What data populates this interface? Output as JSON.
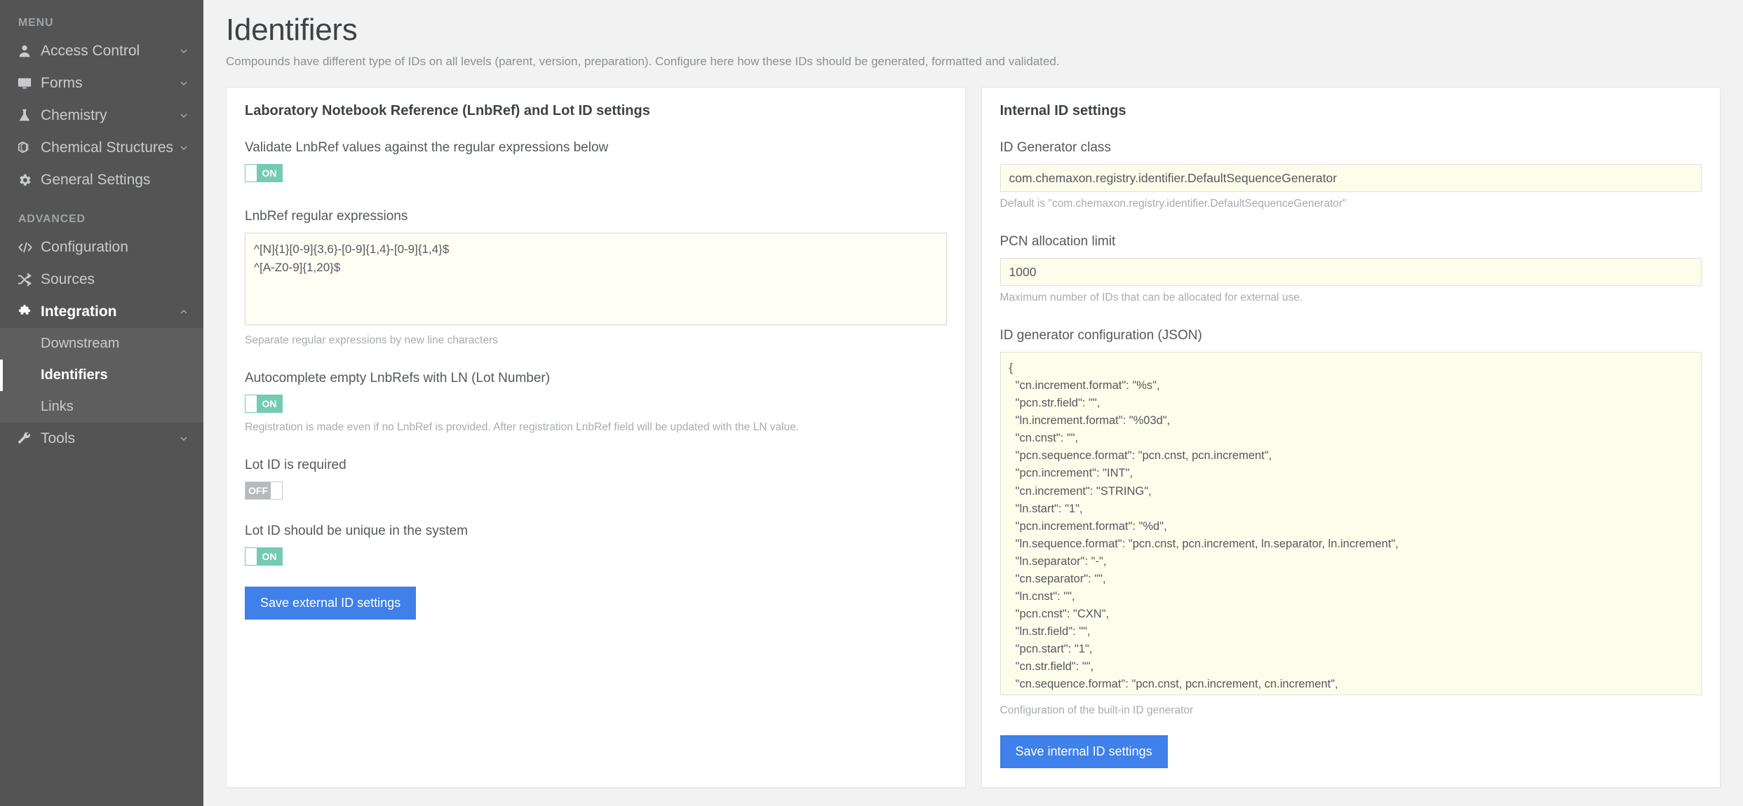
{
  "sidebar": {
    "section_menu_label": "MENU",
    "section_advanced_label": "ADVANCED",
    "menu_items": [
      {
        "label": "Access Control",
        "icon": "user-icon",
        "chevron": "chevron-down"
      },
      {
        "label": "Forms",
        "icon": "monitor-icon",
        "chevron": "chevron-down"
      },
      {
        "label": "Chemistry",
        "icon": "flask-icon",
        "chevron": "chevron-down"
      },
      {
        "label": "Chemical Structures",
        "icon": "cube-icon",
        "chevron": "chevron-down"
      },
      {
        "label": "General Settings",
        "icon": "gear-icon",
        "chevron": ""
      }
    ],
    "advanced_items": [
      {
        "label": "Configuration",
        "icon": "code-icon",
        "chevron": ""
      },
      {
        "label": "Sources",
        "icon": "shuffle-icon",
        "chevron": ""
      },
      {
        "label": "Integration",
        "icon": "puzzle-icon",
        "chevron": "chevron-up"
      }
    ],
    "integration_submenu": [
      {
        "label": "Downstream",
        "active": false
      },
      {
        "label": "Identifiers",
        "active": true
      },
      {
        "label": "Links",
        "active": false
      }
    ],
    "tools_item": {
      "label": "Tools",
      "icon": "wrench-icon",
      "chevron": "chevron-down"
    }
  },
  "header": {
    "title": "Identifiers",
    "subtitle": "Compounds have different type of IDs on all levels (parent, version, preparation). Configure here how these IDs should be generated, formatted and validated."
  },
  "left_panel": {
    "title": "Laboratory Notebook Reference (LnbRef) and Lot ID settings",
    "validate_label": "Validate LnbRef values against the regular expressions below",
    "validate_toggle": "ON",
    "regex_label": "LnbRef regular expressions",
    "regex_value": "^[N]{1}[0-9]{3,6}-[0-9]{1,4}-[0-9]{1,4}$\n^[A-Z0-9]{1,20}$",
    "regex_hint": "Separate regular expressions by new line characters",
    "autocomplete_label": "Autocomplete empty LnbRefs with LN (Lot Number)",
    "autocomplete_toggle": "ON",
    "autocomplete_hint": "Registration is made even if no LnbRef is provided. After registration LnbRef field will be updated with the LN value.",
    "lot_required_label": "Lot ID is required",
    "lot_required_toggle": "OFF",
    "lot_unique_label": "Lot ID should be unique in the system",
    "lot_unique_toggle": "ON",
    "save_button": "Save external ID settings"
  },
  "right_panel": {
    "title": "Internal ID settings",
    "generator_label": "ID Generator class",
    "generator_value": "com.chemaxon.registry.identifier.DefaultSequenceGenerator",
    "generator_hint": "Default is \"com.chemaxon.registry.identifier.DefaultSequenceGenerator\"",
    "pcn_label": "PCN allocation limit",
    "pcn_value": "1000",
    "pcn_hint": "Maximum number of IDs that can be allocated for external use.",
    "json_label": "ID generator configuration (JSON)",
    "json_value": "{\n  \"cn.increment.format\": \"%s\",\n  \"pcn.str.field\": \"\",\n  \"ln.increment.format\": \"%03d\",\n  \"cn.cnst\": \"\",\n  \"pcn.sequence.format\": \"pcn.cnst, pcn.increment\",\n  \"pcn.increment\": \"INT\",\n  \"cn.increment\": \"STRING\",\n  \"ln.start\": \"1\",\n  \"pcn.increment.format\": \"%d\",\n  \"ln.sequence.format\": \"pcn.cnst, pcn.increment, ln.separator, ln.increment\",\n  \"ln.separator\": \"-\",\n  \"cn.separator\": \"\",\n  \"ln.cnst\": \"\",\n  \"pcn.cnst\": \"CXN\",\n  \"ln.str.field\": \"\",\n  \"pcn.start\": \"1\",\n  \"cn.str.field\": \"\",\n  \"cn.sequence.format\": \"pcn.cnst, pcn.increment, cn.increment\",\n  \"ln.increment\": \"INT\",\n  \"cn.start\": \"A\",\n  \"pcn.separator\": \"\"\n}",
    "json_hint": "Configuration of the built-in ID generator",
    "save_button": "Save internal ID settings"
  },
  "colors": {
    "sidebar_bg": "#545454",
    "submenu_bg": "#5e5e5e",
    "toggle_on": "#74cbb2",
    "toggle_off": "#b6babd",
    "primary_button": "#3f80ea",
    "input_bg": "#fdfdec"
  }
}
